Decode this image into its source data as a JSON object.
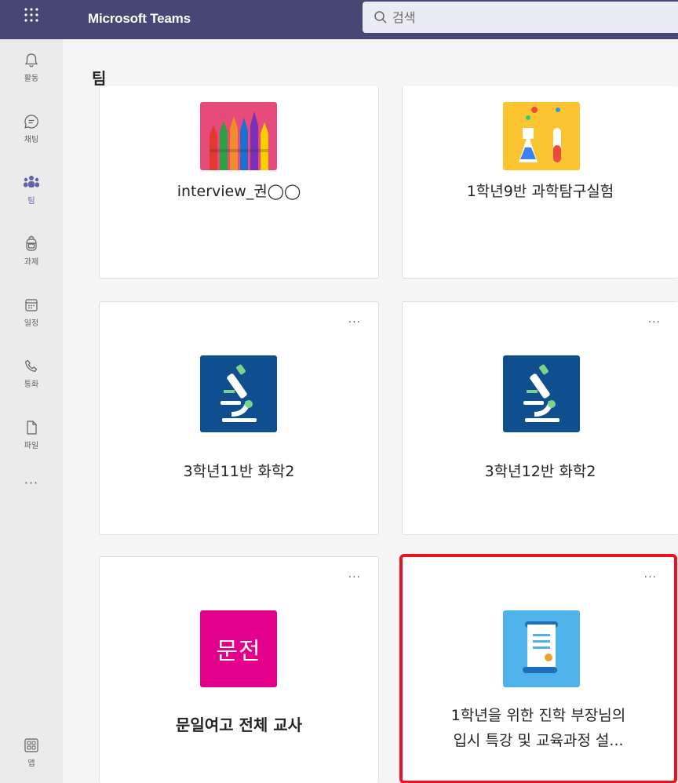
{
  "app": {
    "title": "Microsoft Teams"
  },
  "search": {
    "placeholder": "검색"
  },
  "rail": {
    "items": [
      {
        "label": "활동",
        "icon": "bell-icon"
      },
      {
        "label": "채팅",
        "icon": "chat-icon"
      },
      {
        "label": "팀",
        "icon": "teams-icon",
        "active": true
      },
      {
        "label": "과제",
        "icon": "backpack-icon"
      },
      {
        "label": "일정",
        "icon": "calendar-icon"
      },
      {
        "label": "통화",
        "icon": "phone-icon"
      },
      {
        "label": "파일",
        "icon": "file-icon"
      }
    ],
    "more": "···",
    "apps_label": "앱"
  },
  "page": {
    "title": "팀"
  },
  "teams": [
    {
      "name": "interview_권◯◯",
      "avatar": "pencils"
    },
    {
      "name": "1학년9반 과학탐구실험",
      "avatar": "flasks"
    },
    {
      "name": "3학년11반 화학2",
      "avatar": "microscope"
    },
    {
      "name": "3학년12반 화학2",
      "avatar": "microscope"
    },
    {
      "name": "문일여고 전체 교사",
      "avatar": "initials",
      "initials": "문전",
      "color": "#e3008c"
    },
    {
      "name_line1": "1학년을 위한 진학 부장님의",
      "name_line2": "입시 특강 및 교육과정 설...",
      "avatar": "scroll",
      "highlighted": true
    }
  ],
  "card_more": "···",
  "colors": {
    "topbar": "#464775",
    "accent": "#6264a7",
    "highlight": "#e8141f"
  }
}
